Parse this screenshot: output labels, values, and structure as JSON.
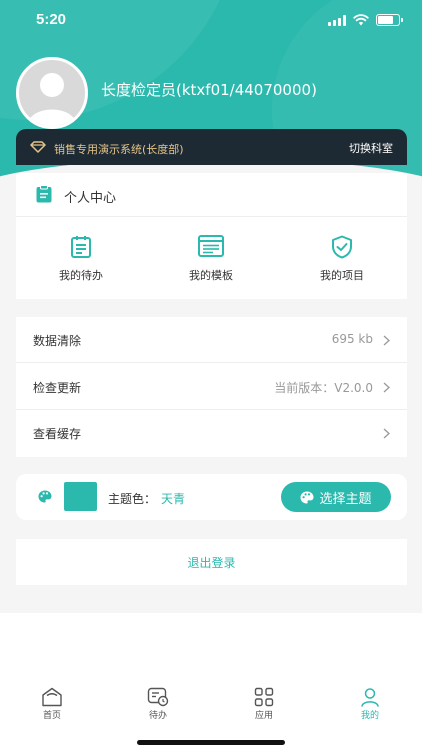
{
  "status_bar": {
    "time": "5:20"
  },
  "profile": {
    "name": "长度检定员(ktxf01/44070000)"
  },
  "system_bar": {
    "system_name": "销售专用演示系统(长度部)",
    "switch_label": "切换科室"
  },
  "personal_center": {
    "title": "个人中心",
    "items": [
      {
        "label": "我的待办",
        "icon": "todo-list-icon"
      },
      {
        "label": "我的模板",
        "icon": "template-icon"
      },
      {
        "label": "我的项目",
        "icon": "shield-check-icon"
      }
    ]
  },
  "settings": [
    {
      "label": "数据清除",
      "value": "695 kb"
    },
    {
      "label": "检查更新",
      "value": "当前版本：V2.0.0"
    },
    {
      "label": "查看缓存",
      "value": ""
    }
  ],
  "theme": {
    "label": "主题色：",
    "value": "天青",
    "button_label": "选择主题",
    "color": "#2bb9ad"
  },
  "logout_label": "退出登录",
  "tabbar": [
    {
      "label": "首页",
      "icon": "home-icon"
    },
    {
      "label": "待办",
      "icon": "todo-icon"
    },
    {
      "label": "应用",
      "icon": "apps-icon"
    },
    {
      "label": "我的",
      "icon": "user-icon"
    }
  ],
  "colors": {
    "accent": "#2bb9ad",
    "gold": "#e3c48a",
    "dark_bar": "#1e2a33"
  }
}
